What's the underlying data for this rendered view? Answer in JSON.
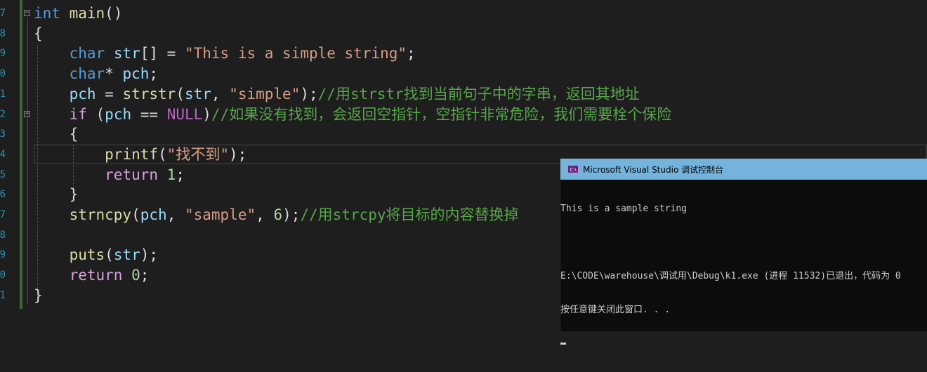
{
  "editor": {
    "line_numbers": [
      "7",
      "8",
      "9",
      "0",
      "1",
      "2",
      "3",
      "4",
      "5",
      "6",
      "7",
      "8",
      "9",
      "0",
      "1"
    ],
    "lines": [
      [
        {
          "t": "int",
          "c": "kw"
        },
        {
          "t": " ",
          "c": "op"
        },
        {
          "t": "main",
          "c": "fn"
        },
        {
          "t": "()",
          "c": "op"
        }
      ],
      [
        {
          "t": "{",
          "c": "op"
        }
      ],
      [
        {
          "t": "    ",
          "c": "op"
        },
        {
          "t": "char",
          "c": "kw"
        },
        {
          "t": " ",
          "c": "op"
        },
        {
          "t": "str",
          "c": "id"
        },
        {
          "t": "[] = ",
          "c": "op"
        },
        {
          "t": "\"This is a simple string\"",
          "c": "str"
        },
        {
          "t": ";",
          "c": "op"
        }
      ],
      [
        {
          "t": "    ",
          "c": "op"
        },
        {
          "t": "char",
          "c": "kw"
        },
        {
          "t": "* ",
          "c": "op"
        },
        {
          "t": "pch",
          "c": "id"
        },
        {
          "t": ";",
          "c": "op"
        }
      ],
      [
        {
          "t": "    ",
          "c": "op"
        },
        {
          "t": "pch",
          "c": "id"
        },
        {
          "t": " = ",
          "c": "op"
        },
        {
          "t": "strstr",
          "c": "fn"
        },
        {
          "t": "(",
          "c": "op"
        },
        {
          "t": "str",
          "c": "id"
        },
        {
          "t": ", ",
          "c": "op"
        },
        {
          "t": "\"simple\"",
          "c": "str"
        },
        {
          "t": ");",
          "c": "op"
        },
        {
          "t": "//用strstr找到当前句子中的字串，返回其地址",
          "c": "cm"
        }
      ],
      [
        {
          "t": "    ",
          "c": "op"
        },
        {
          "t": "if",
          "c": "ctl"
        },
        {
          "t": " (",
          "c": "op"
        },
        {
          "t": "pch",
          "c": "id"
        },
        {
          "t": " == ",
          "c": "op"
        },
        {
          "t": "NULL",
          "c": "macro"
        },
        {
          "t": ")",
          "c": "op"
        },
        {
          "t": "//如果没有找到，会返回空指针，空指针非常危险，我们需要栓个保险",
          "c": "cm"
        }
      ],
      [
        {
          "t": "    {",
          "c": "op"
        }
      ],
      [
        {
          "t": "        ",
          "c": "op"
        },
        {
          "t": "printf",
          "c": "fn"
        },
        {
          "t": "(",
          "c": "op"
        },
        {
          "t": "\"找不到\"",
          "c": "str"
        },
        {
          "t": ");",
          "c": "op"
        }
      ],
      [
        {
          "t": "        ",
          "c": "op"
        },
        {
          "t": "return",
          "c": "ctl"
        },
        {
          "t": " ",
          "c": "op"
        },
        {
          "t": "1",
          "c": "num"
        },
        {
          "t": ";",
          "c": "op"
        }
      ],
      [
        {
          "t": "    }",
          "c": "op"
        }
      ],
      [
        {
          "t": "    ",
          "c": "op"
        },
        {
          "t": "strncpy",
          "c": "fn"
        },
        {
          "t": "(",
          "c": "op"
        },
        {
          "t": "pch",
          "c": "id"
        },
        {
          "t": ", ",
          "c": "op"
        },
        {
          "t": "\"sample\"",
          "c": "str"
        },
        {
          "t": ", ",
          "c": "op"
        },
        {
          "t": "6",
          "c": "num"
        },
        {
          "t": ");",
          "c": "op"
        },
        {
          "t": "//用strcpy将目标的内容替换掉",
          "c": "cm"
        }
      ],
      [
        {
          "t": "",
          "c": "op"
        }
      ],
      [
        {
          "t": "    ",
          "c": "op"
        },
        {
          "t": "puts",
          "c": "fn"
        },
        {
          "t": "(",
          "c": "op"
        },
        {
          "t": "str",
          "c": "id"
        },
        {
          "t": ");",
          "c": "op"
        }
      ],
      [
        {
          "t": "    ",
          "c": "op"
        },
        {
          "t": "return",
          "c": "ctl"
        },
        {
          "t": " ",
          "c": "op"
        },
        {
          "t": "0",
          "c": "num"
        },
        {
          "t": ";",
          "c": "op"
        }
      ],
      [
        {
          "t": "}",
          "c": "op"
        }
      ]
    ]
  },
  "console": {
    "title": "Microsoft Visual Studio 调试控制台",
    "icon_label": "C:\\",
    "output_line1": "This is a sample string",
    "output_line2": "",
    "output_line3": "E:\\CODE\\warehouse\\调试用\\Debug\\k1.exe (进程 11532)已退出，代码为 0",
    "output_line4": "按任意键关闭此窗口. . ."
  },
  "colors": {
    "background": "#1e1e1e",
    "keyword": "#569cd6",
    "comment": "#57a64a",
    "string": "#d69d85",
    "console_title_bg": "#74b4dc"
  }
}
